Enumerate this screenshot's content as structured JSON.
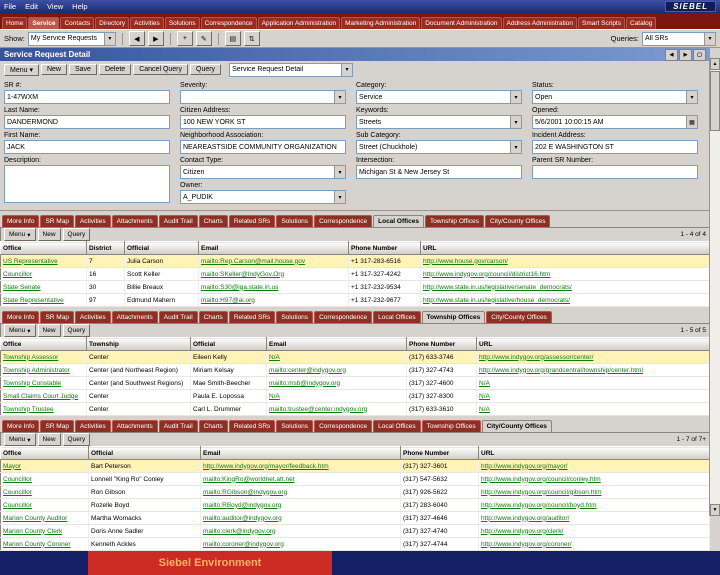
{
  "colors": {
    "accent_blue": "#35549c",
    "tab_red": "#7e150e",
    "link_green": "#127a12",
    "selected_row": "#fff3b8",
    "footer_navy": "#141f66",
    "footer_red": "#cc2b24",
    "footer_text": "#ffb366"
  },
  "icons": {
    "chevron_down": "▾",
    "calendar": "▦",
    "scroll_up": "▲",
    "scroll_down": "▼",
    "record_prev": "◀",
    "record_next": "▶",
    "back": "◀",
    "forward": "▶",
    "new_record": "+",
    "edit": "✎",
    "print": "▤",
    "refresh": "⇅",
    "minimize": "▁",
    "maximize": "▢"
  },
  "menu_bar": {
    "items": [
      "File",
      "Edit",
      "View",
      "Help"
    ],
    "logo": "SIEBEL"
  },
  "screen_tabs": [
    {
      "label": "Home"
    },
    {
      "label": "Service",
      "active": true
    },
    {
      "label": "Contacts"
    },
    {
      "label": "Directory"
    },
    {
      "label": "Activities"
    },
    {
      "label": "Solutions"
    },
    {
      "label": "Correspondence"
    },
    {
      "label": "Application Administration"
    },
    {
      "label": "Marketing Administration"
    },
    {
      "label": "Document Administration"
    },
    {
      "label": "Address Administration"
    },
    {
      "label": "Smart Scripts"
    },
    {
      "label": "Catalog"
    }
  ],
  "toolbar": {
    "show_label": "Show:",
    "show_value": "My Service Requests",
    "queries_label": "Queries:",
    "queries_value": "All SRs"
  },
  "form": {
    "title": "Service Request Detail",
    "buttons": {
      "menu": "Menu",
      "new": "New",
      "save": "Save",
      "delete": "Delete",
      "cancel": "Cancel Query",
      "query": "Query"
    },
    "view_combo": "Service Request Detail",
    "fields": {
      "sr_num": {
        "label": "SR #:",
        "value": "1-47WXM"
      },
      "last_name": {
        "label": "Last Name:",
        "value": "DANDERMOND"
      },
      "first_name": {
        "label": "First Name:",
        "value": "JACK"
      },
      "description": {
        "label": "Description:",
        "value": ""
      },
      "severity": {
        "label": "Severity:",
        "value": ""
      },
      "citizen_address": {
        "label": "Citizen Address:",
        "value": "100 NEW YORK ST"
      },
      "neighborhood": {
        "label": "Neighborhood Association:",
        "value": "NEAREASTSIDE COMMUNITY ORGANIZATION"
      },
      "contact_type": {
        "label": "Contact Type:",
        "value": "Citizen"
      },
      "owner": {
        "label": "Owner:",
        "value": "A_PUDIK"
      },
      "category": {
        "label": "Category:",
        "value": "Service"
      },
      "keywords": {
        "label": "Keywords:",
        "value": "Streets"
      },
      "sub_category": {
        "label": "Sub Category:",
        "value": "Street (Chuckhole)"
      },
      "intersection": {
        "label": "Intersection:",
        "value": "Michigan St & New Jersey St"
      },
      "status": {
        "label": "Status:",
        "value": "Open"
      },
      "opened": {
        "label": "Opened:",
        "value": "5/6/2001 10:00:15 AM"
      },
      "incident_address": {
        "label": "Incident Address:",
        "value": "202 E WASHINGTON ST"
      },
      "parent_sr": {
        "label": "Parent SR Number:",
        "value": ""
      }
    }
  },
  "applets": [
    {
      "id": "local-offices",
      "tabs": [
        {
          "label": "More Info"
        },
        {
          "label": "SR Map"
        },
        {
          "label": "Activities"
        },
        {
          "label": "Attachments"
        },
        {
          "label": "Audit Trail"
        },
        {
          "label": "Charts"
        },
        {
          "label": "Related SRs"
        },
        {
          "label": "Solutions"
        },
        {
          "label": "Correspondence"
        },
        {
          "label": "Local Offices",
          "active": true
        },
        {
          "label": "Township Offices"
        },
        {
          "label": "City/County Offices"
        }
      ],
      "menu_button": "Menu",
      "buttons": [
        "New",
        "Query"
      ],
      "count": "1 - 4 of 4",
      "columns": [
        "Office",
        "District",
        "Official",
        "Email",
        "Phone Number",
        "URL"
      ],
      "rows": [
        [
          "US Representative",
          "7",
          "Julia Carson",
          "mailto:Rep.Carson@mail.house.gov",
          "+1 317-283-6516",
          "http://www.house.gov/carson/"
        ],
        [
          "Councillor",
          "16",
          "Scott Keller",
          "mailto:SKeller@IndyGov.Org",
          "+1 317-327-4242",
          "http://www.indygov.org/council/district16.htm"
        ],
        [
          "State Senate",
          "30",
          "Billie Breaux",
          "mailto:S30@iga.state.in.us",
          "+1 317-232-9534",
          "http://www.state.in.us/legislative/senate_democrats/"
        ],
        [
          "State Representative",
          "97",
          "Edmund Mahern",
          "mailto:H97@ai.org",
          "+1 317-232-9677",
          "http://www.state.in.us/legislative/house_democrats/"
        ]
      ]
    },
    {
      "id": "township-offices",
      "tabs": [
        {
          "label": "More Info"
        },
        {
          "label": "SR Map"
        },
        {
          "label": "Activities"
        },
        {
          "label": "Attachments"
        },
        {
          "label": "Audit Trail"
        },
        {
          "label": "Charts"
        },
        {
          "label": "Related SRs"
        },
        {
          "label": "Solutions"
        },
        {
          "label": "Correspondence"
        },
        {
          "label": "Local Offices"
        },
        {
          "label": "Township Offices",
          "active": true
        },
        {
          "label": "City/County Offices"
        }
      ],
      "menu_button": "Menu",
      "buttons": [
        "New",
        "Query"
      ],
      "count": "1 - 5 of 5",
      "columns": [
        "Office",
        "Township",
        "Official",
        "Email",
        "Phone Number",
        "URL"
      ],
      "rows": [
        [
          "Township Assessor",
          "Center",
          "Eileen Kelly",
          "N/A",
          "(317) 633-3746",
          "http://www.indygov.org/assessor/center/"
        ],
        [
          "Township Administrator",
          "Center (and Northeast Region)",
          "Miriam Kelsay",
          "mailto:center@indygov.org",
          "(317) 327-4743",
          "http://www.indygov.org/grandcentral/township/center.html"
        ],
        [
          "Township Constable",
          "Center (and Southwest Regions)",
          "Mae Smith-Beecher",
          "mailto:msb@indygov.org",
          "(317) 327-4600",
          "N/A"
        ],
        [
          "Small Claims Court Judge",
          "Center",
          "Paula E. Lopossa",
          "N/A",
          "(317) 327-8300",
          "N/A"
        ],
        [
          "Township Trustee",
          "Center",
          "Carl L. Drummer",
          "mailto:trustee@center.indygov.org",
          "(317) 633-3610",
          "N/A"
        ]
      ]
    },
    {
      "id": "city-county-offices",
      "tabs": [
        {
          "label": "More Info"
        },
        {
          "label": "SR Map"
        },
        {
          "label": "Activities"
        },
        {
          "label": "Attachments"
        },
        {
          "label": "Audit Trail"
        },
        {
          "label": "Charts"
        },
        {
          "label": "Related SRs"
        },
        {
          "label": "Solutions"
        },
        {
          "label": "Correspondence"
        },
        {
          "label": "Local Offices"
        },
        {
          "label": "Township Offices"
        },
        {
          "label": "City/County Offices",
          "active": true
        }
      ],
      "menu_button": "Menu",
      "buttons": [
        "New",
        "Query"
      ],
      "count": "1 - 7 of 7+",
      "columns": [
        "Office",
        "Official",
        "Email",
        "Phone Number",
        "URL"
      ],
      "rows": [
        [
          "Mayor",
          "Bart Peterson",
          "http://www.indygov.org/mayor/feedback.htm",
          "(317) 327-3601",
          "http://www.indygov.org/mayor/"
        ],
        [
          "Councillor",
          "Lonnell \"King Ro\" Conley",
          "mailto:KingRo@worldnet.att.net",
          "(317) 547-5632",
          "http://www.indygov.org/council/conley.htm"
        ],
        [
          "Councillor",
          "Ron Gibson",
          "mailto:RGibson@indygov.org",
          "(317) 926-5622",
          "http://www.indygov.org/council/gibson.htm"
        ],
        [
          "Councillor",
          "Rozelle Boyd",
          "mailto:RBoyd@indygov.org",
          "(317) 283-6040",
          "http://www.indygov.org/council/boyd.htm"
        ],
        [
          "Marion County Auditor",
          "Martha Womacks",
          "mailto:auditor@indygov.org",
          "(317) 327-4646",
          "http://www.indygov.org/auditor/"
        ],
        [
          "Marion County Clerk",
          "Doris Anne Sadler",
          "mailto:clerk@indygov.org",
          "(317) 327-4740",
          "http://www.indygov.org/clerk/"
        ],
        [
          "Marion County Coroner",
          "Kenneth Ackles",
          "mailto:coroner@indygov.org",
          "(317) 327-4744",
          "http://www.indygov.org/coroner/"
        ]
      ]
    }
  ],
  "footer": {
    "label": "Siebel Environment"
  }
}
